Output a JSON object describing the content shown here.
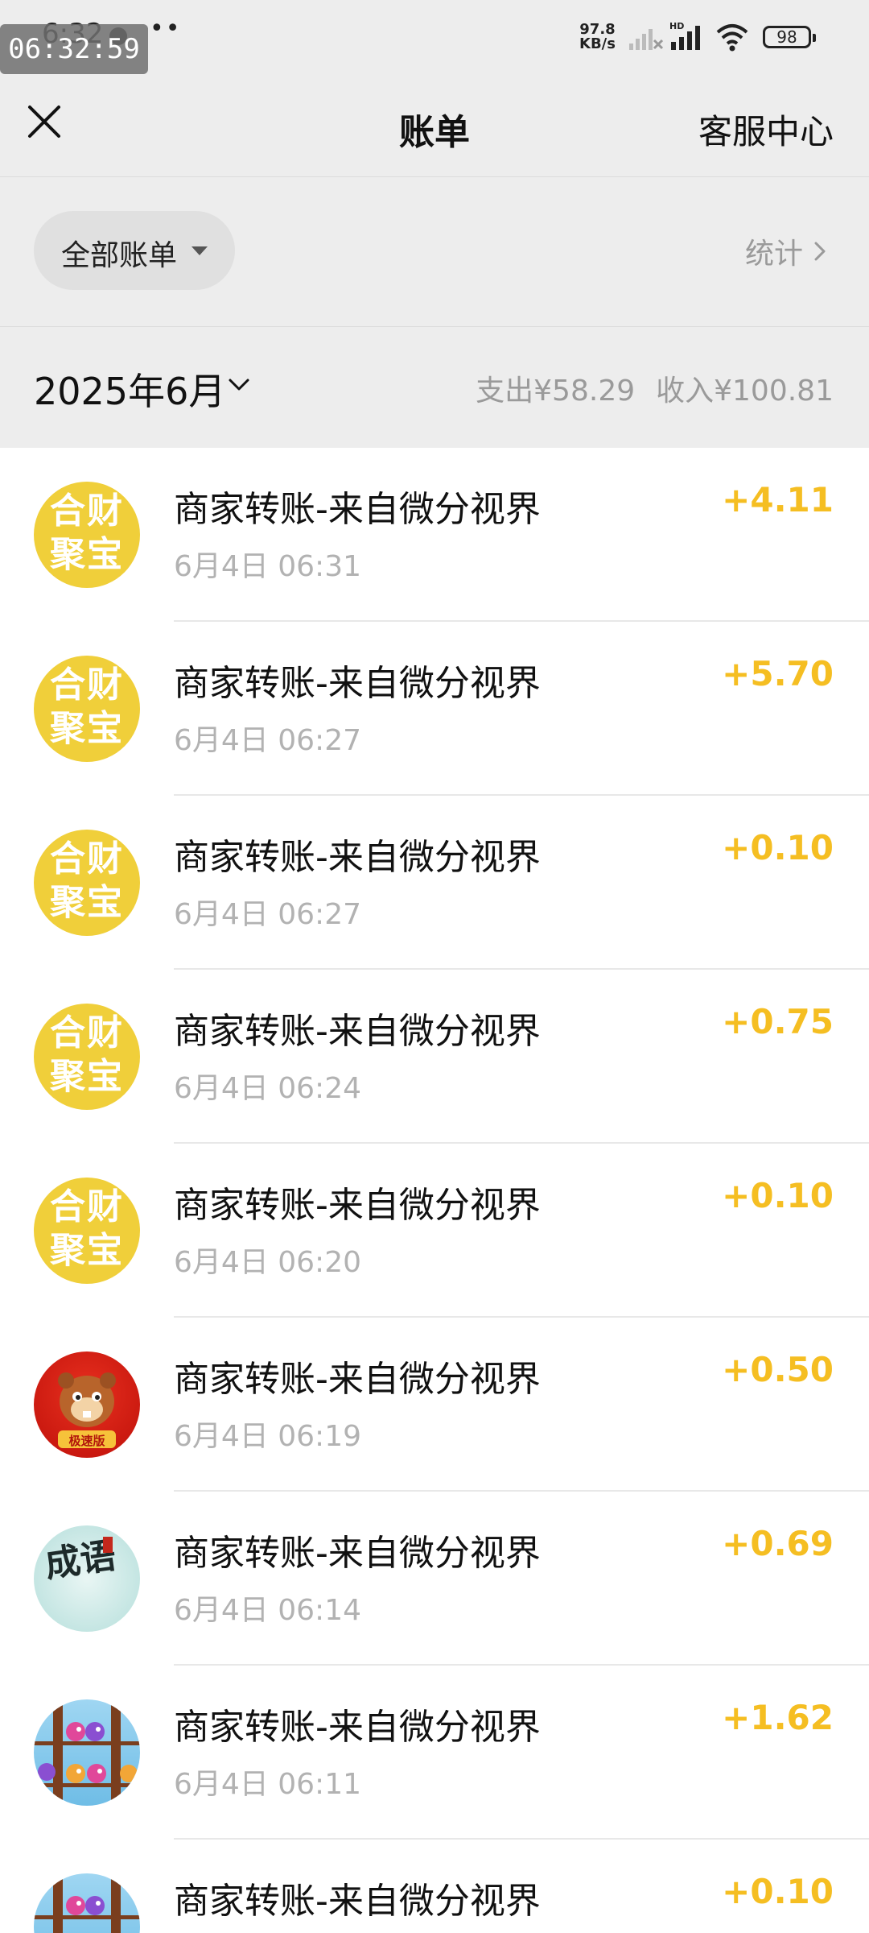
{
  "status_bar": {
    "time": "6:32",
    "more": "••",
    "overlay_clock": "06:32:59",
    "net_speed_value": "97.8",
    "net_speed_unit": "KB/s",
    "hd_label": "HD",
    "battery": "98"
  },
  "nav": {
    "title": "账单",
    "service_label": "客服中心"
  },
  "filter": {
    "label": "全部账单",
    "stats_label": "统计"
  },
  "month": {
    "label": "2025年6月",
    "expense": "支出¥58.29",
    "income": "收入¥100.81"
  },
  "colors": {
    "amount": "#f5be22",
    "background": "#ededed",
    "list_background": "#ffffff"
  },
  "bills": [
    {
      "title": "商家转账-来自微分视界",
      "time": "6月4日 06:31",
      "amount": "+4.11",
      "avatar_icon": "gold-treasure-icon",
      "avatar_text": "合财\n聚宝"
    },
    {
      "title": "商家转账-来自微分视界",
      "time": "6月4日 06:27",
      "amount": "+5.70",
      "avatar_icon": "gold-treasure-icon",
      "avatar_text": "合财\n聚宝"
    },
    {
      "title": "商家转账-来自微分视界",
      "time": "6月4日 06:27",
      "amount": "+0.10",
      "avatar_icon": "gold-treasure-icon",
      "avatar_text": "合财\n聚宝"
    },
    {
      "title": "商家转账-来自微分视界",
      "time": "6月4日 06:24",
      "amount": "+0.75",
      "avatar_icon": "gold-treasure-icon",
      "avatar_text": "合财\n聚宝"
    },
    {
      "title": "商家转账-来自微分视界",
      "time": "6月4日 06:20",
      "amount": "+0.10",
      "avatar_icon": "gold-treasure-icon",
      "avatar_text": "合财\n聚宝"
    },
    {
      "title": "商家转账-来自微分视界",
      "time": "6月4日 06:19",
      "amount": "+0.50",
      "avatar_icon": "beaver-mascot-icon",
      "avatar_text": "极速版"
    },
    {
      "title": "商家转账-来自微分视界",
      "time": "6月4日 06:14",
      "amount": "+0.69",
      "avatar_icon": "idiom-game-icon",
      "avatar_text": "成语"
    },
    {
      "title": "商家转账-来自微分视界",
      "time": "6月4日 06:11",
      "amount": "+1.62",
      "avatar_icon": "bird-sort-game-icon",
      "avatar_text": ""
    },
    {
      "title": "商家转账-来自微分视界",
      "time": "",
      "amount": "+0.10",
      "avatar_icon": "bird-sort-game-icon",
      "avatar_text": ""
    }
  ]
}
